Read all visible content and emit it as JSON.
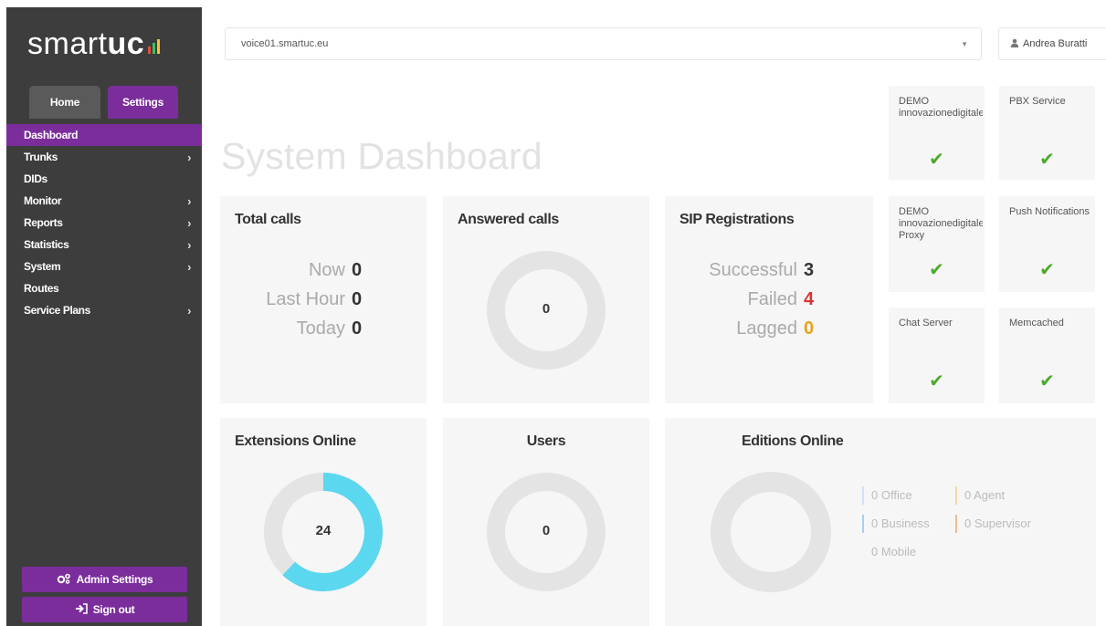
{
  "sidebar": {
    "logo": {
      "text_light": "smart",
      "text_bold": "uc"
    },
    "tabs": [
      {
        "label": "Home"
      },
      {
        "label": "Settings"
      }
    ],
    "items": [
      {
        "label": "Dashboard",
        "has_submenu": false,
        "active": true
      },
      {
        "label": "Trunks",
        "has_submenu": true
      },
      {
        "label": "DIDs",
        "has_submenu": false
      },
      {
        "label": "Monitor",
        "has_submenu": true
      },
      {
        "label": "Reports",
        "has_submenu": true
      },
      {
        "label": "Statistics",
        "has_submenu": true
      },
      {
        "label": "System",
        "has_submenu": true
      },
      {
        "label": "Routes",
        "has_submenu": false
      },
      {
        "label": "Service Plans",
        "has_submenu": true
      }
    ],
    "admin_settings_label": "Admin Settings",
    "sign_out_label": "Sign out"
  },
  "header": {
    "server_value": "voice01.smartuc.eu",
    "user_label": "Andrea Buratti"
  },
  "page_title": "System Dashboard",
  "cards": {
    "total_calls": {
      "title": "Total calls",
      "rows": [
        {
          "label": "Now",
          "value": "0"
        },
        {
          "label": "Last Hour",
          "value": "0"
        },
        {
          "label": "Today",
          "value": "0"
        }
      ]
    },
    "answered_calls": {
      "title": "Answered calls",
      "value": "0",
      "fraction": 0
    },
    "sip_registrations": {
      "title": "SIP Registrations",
      "rows": [
        {
          "label": "Successful",
          "value": "3"
        },
        {
          "label": "Failed",
          "value": "4"
        },
        {
          "label": "Lagged",
          "value": "0"
        }
      ]
    },
    "extensions_online": {
      "title": "Extensions Online",
      "value": "24",
      "fraction": 0.62
    },
    "users": {
      "title": "Users",
      "value": "0",
      "fraction": 0
    },
    "editions_online": {
      "title": "Editions Online",
      "legend": [
        {
          "label": "0 Office",
          "color": "#cfe3f5"
        },
        {
          "label": "0 Agent",
          "color": "#f3d6a8"
        },
        {
          "label": "0 Business",
          "color": "#a9cdef"
        },
        {
          "label": "0 Supervisor",
          "color": "#e8bf94"
        },
        {
          "label": "0 Mobile",
          "color": "#f7f6f6"
        }
      ]
    }
  },
  "services": [
    {
      "name": "DEMO innovazionedigitale",
      "status": "ok"
    },
    {
      "name": "PBX Service",
      "status": "ok"
    },
    {
      "name": "DEMO innovazionedigitale Proxy",
      "status": "ok"
    },
    {
      "name": "Push Notifications",
      "status": "ok"
    },
    {
      "name": "Chat Server",
      "status": "ok"
    },
    {
      "name": "Memcached",
      "status": "ok"
    }
  ],
  "colors": {
    "accent": "#7b2d9c",
    "sidebar_bg": "#3d3d3d",
    "donut_fill": "#5bd7ef",
    "donut_track": "#e4e4e4",
    "ok_check": "#4caa2b",
    "failed": "#dd3333",
    "lagged": "#e9a21b"
  }
}
